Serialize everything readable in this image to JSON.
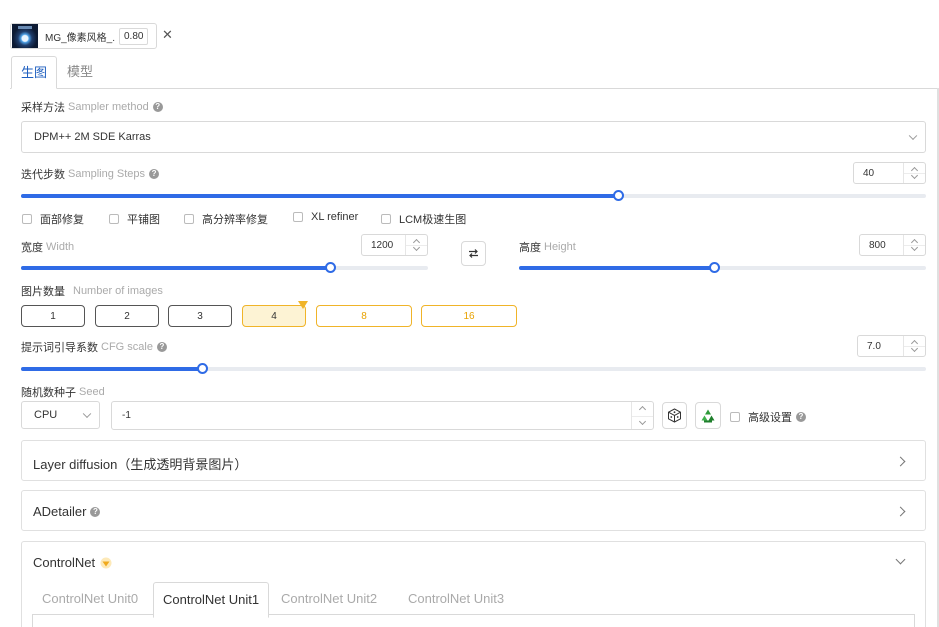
{
  "lora": {
    "name": "MG_像素风格_...",
    "weight": "0.80",
    "close_icon": "close-icon"
  },
  "tabs": [
    {
      "label": "生图",
      "active": true
    },
    {
      "label": "模型",
      "active": false
    }
  ],
  "sampler": {
    "label": "采样方法",
    "label_en": "Sampler method",
    "value": "DPM++ 2M SDE Karras"
  },
  "steps": {
    "label": "迭代步数",
    "label_en": "Sampling Steps",
    "value": "40",
    "slider_fraction": 0.66
  },
  "options": [
    {
      "label": "面部修复",
      "checked": false
    },
    {
      "label": "平铺图",
      "checked": false
    },
    {
      "label": "高分辨率修复",
      "checked": false
    },
    {
      "label": "XL refiner",
      "checked": false
    },
    {
      "label": "LCM极速生图",
      "checked": false
    }
  ],
  "width": {
    "label": "宽度",
    "label_en": "Width",
    "value": "1200",
    "slider_fraction": 0.76
  },
  "height": {
    "label": "高度",
    "label_en": "Height",
    "value": "800",
    "slider_fraction": 0.48
  },
  "swap_icon": "swap-arrows-icon",
  "num_images": {
    "label": "图片数量",
    "label_en": "Number of images",
    "options": [
      "1",
      "2",
      "3",
      "4",
      "8",
      "16"
    ],
    "selected": "4"
  },
  "cfg": {
    "label": "提示词引导系数",
    "label_en": "CFG scale",
    "value": "7.0",
    "slider_fraction": 0.2
  },
  "seed": {
    "label": "随机数种子",
    "label_en": "Seed",
    "device": "CPU",
    "value": "-1",
    "dice_icon": "dice-icon",
    "recycle_icon": "recycle-icon",
    "advanced_label": "高级设置"
  },
  "panels": {
    "layer_diffusion": "Layer diffusion（生成透明背景图片）",
    "adetailer": "ADetailer",
    "controlnet": "ControlNet"
  },
  "controlnet_units": [
    {
      "label": "ControlNet Unit0",
      "active": false
    },
    {
      "label": "ControlNet Unit1",
      "active": true
    },
    {
      "label": "ControlNet Unit2",
      "active": false
    },
    {
      "label": "ControlNet Unit3",
      "active": false
    }
  ],
  "colors": {
    "accent": "#2f6be6",
    "gold": "#f0b429",
    "tab_active": "#1f5fbf"
  }
}
